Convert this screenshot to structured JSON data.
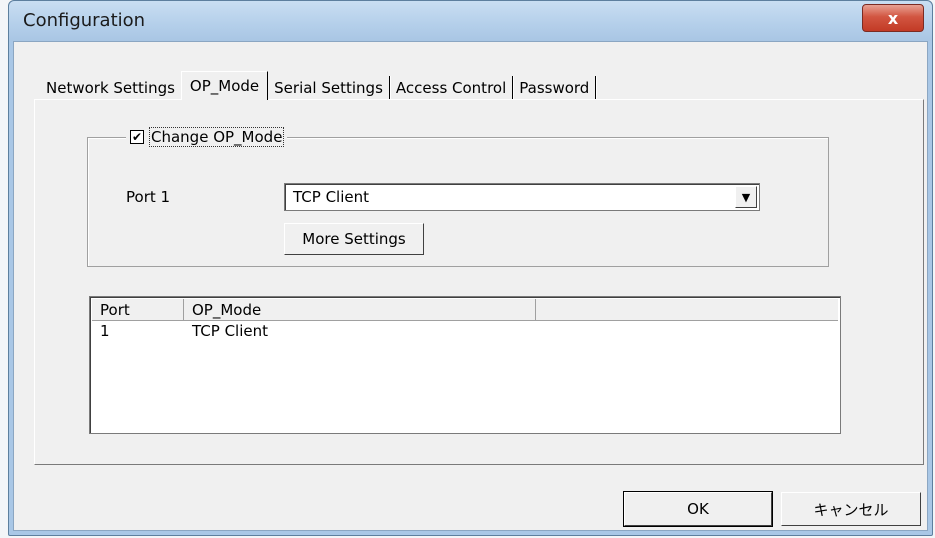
{
  "window": {
    "title": "Configuration",
    "close_label": "x"
  },
  "tabs": [
    {
      "label": "Network Settings",
      "active": false
    },
    {
      "label": "OP_Mode",
      "active": true
    },
    {
      "label": "Serial Settings",
      "active": false
    },
    {
      "label": "Access Control",
      "active": false
    },
    {
      "label": "Password",
      "active": false
    }
  ],
  "group": {
    "checkbox_label": "Change OP_Mode",
    "checked": true,
    "checkmark": "✔",
    "port_label": "Port 1",
    "op_mode_select": {
      "value": "TCP Client",
      "arrow": "▼"
    },
    "more_settings_label": "More Settings"
  },
  "table": {
    "columns": [
      "Port",
      "OP_Mode"
    ],
    "rows": [
      {
        "port": "1",
        "op_mode": "TCP Client"
      }
    ]
  },
  "buttons": {
    "ok": "OK",
    "cancel": "キャンセル"
  },
  "colors": {
    "title_bar": "#b4cfea",
    "close_button": "#c23a26",
    "dialog_bg": "#f0f0f0"
  }
}
